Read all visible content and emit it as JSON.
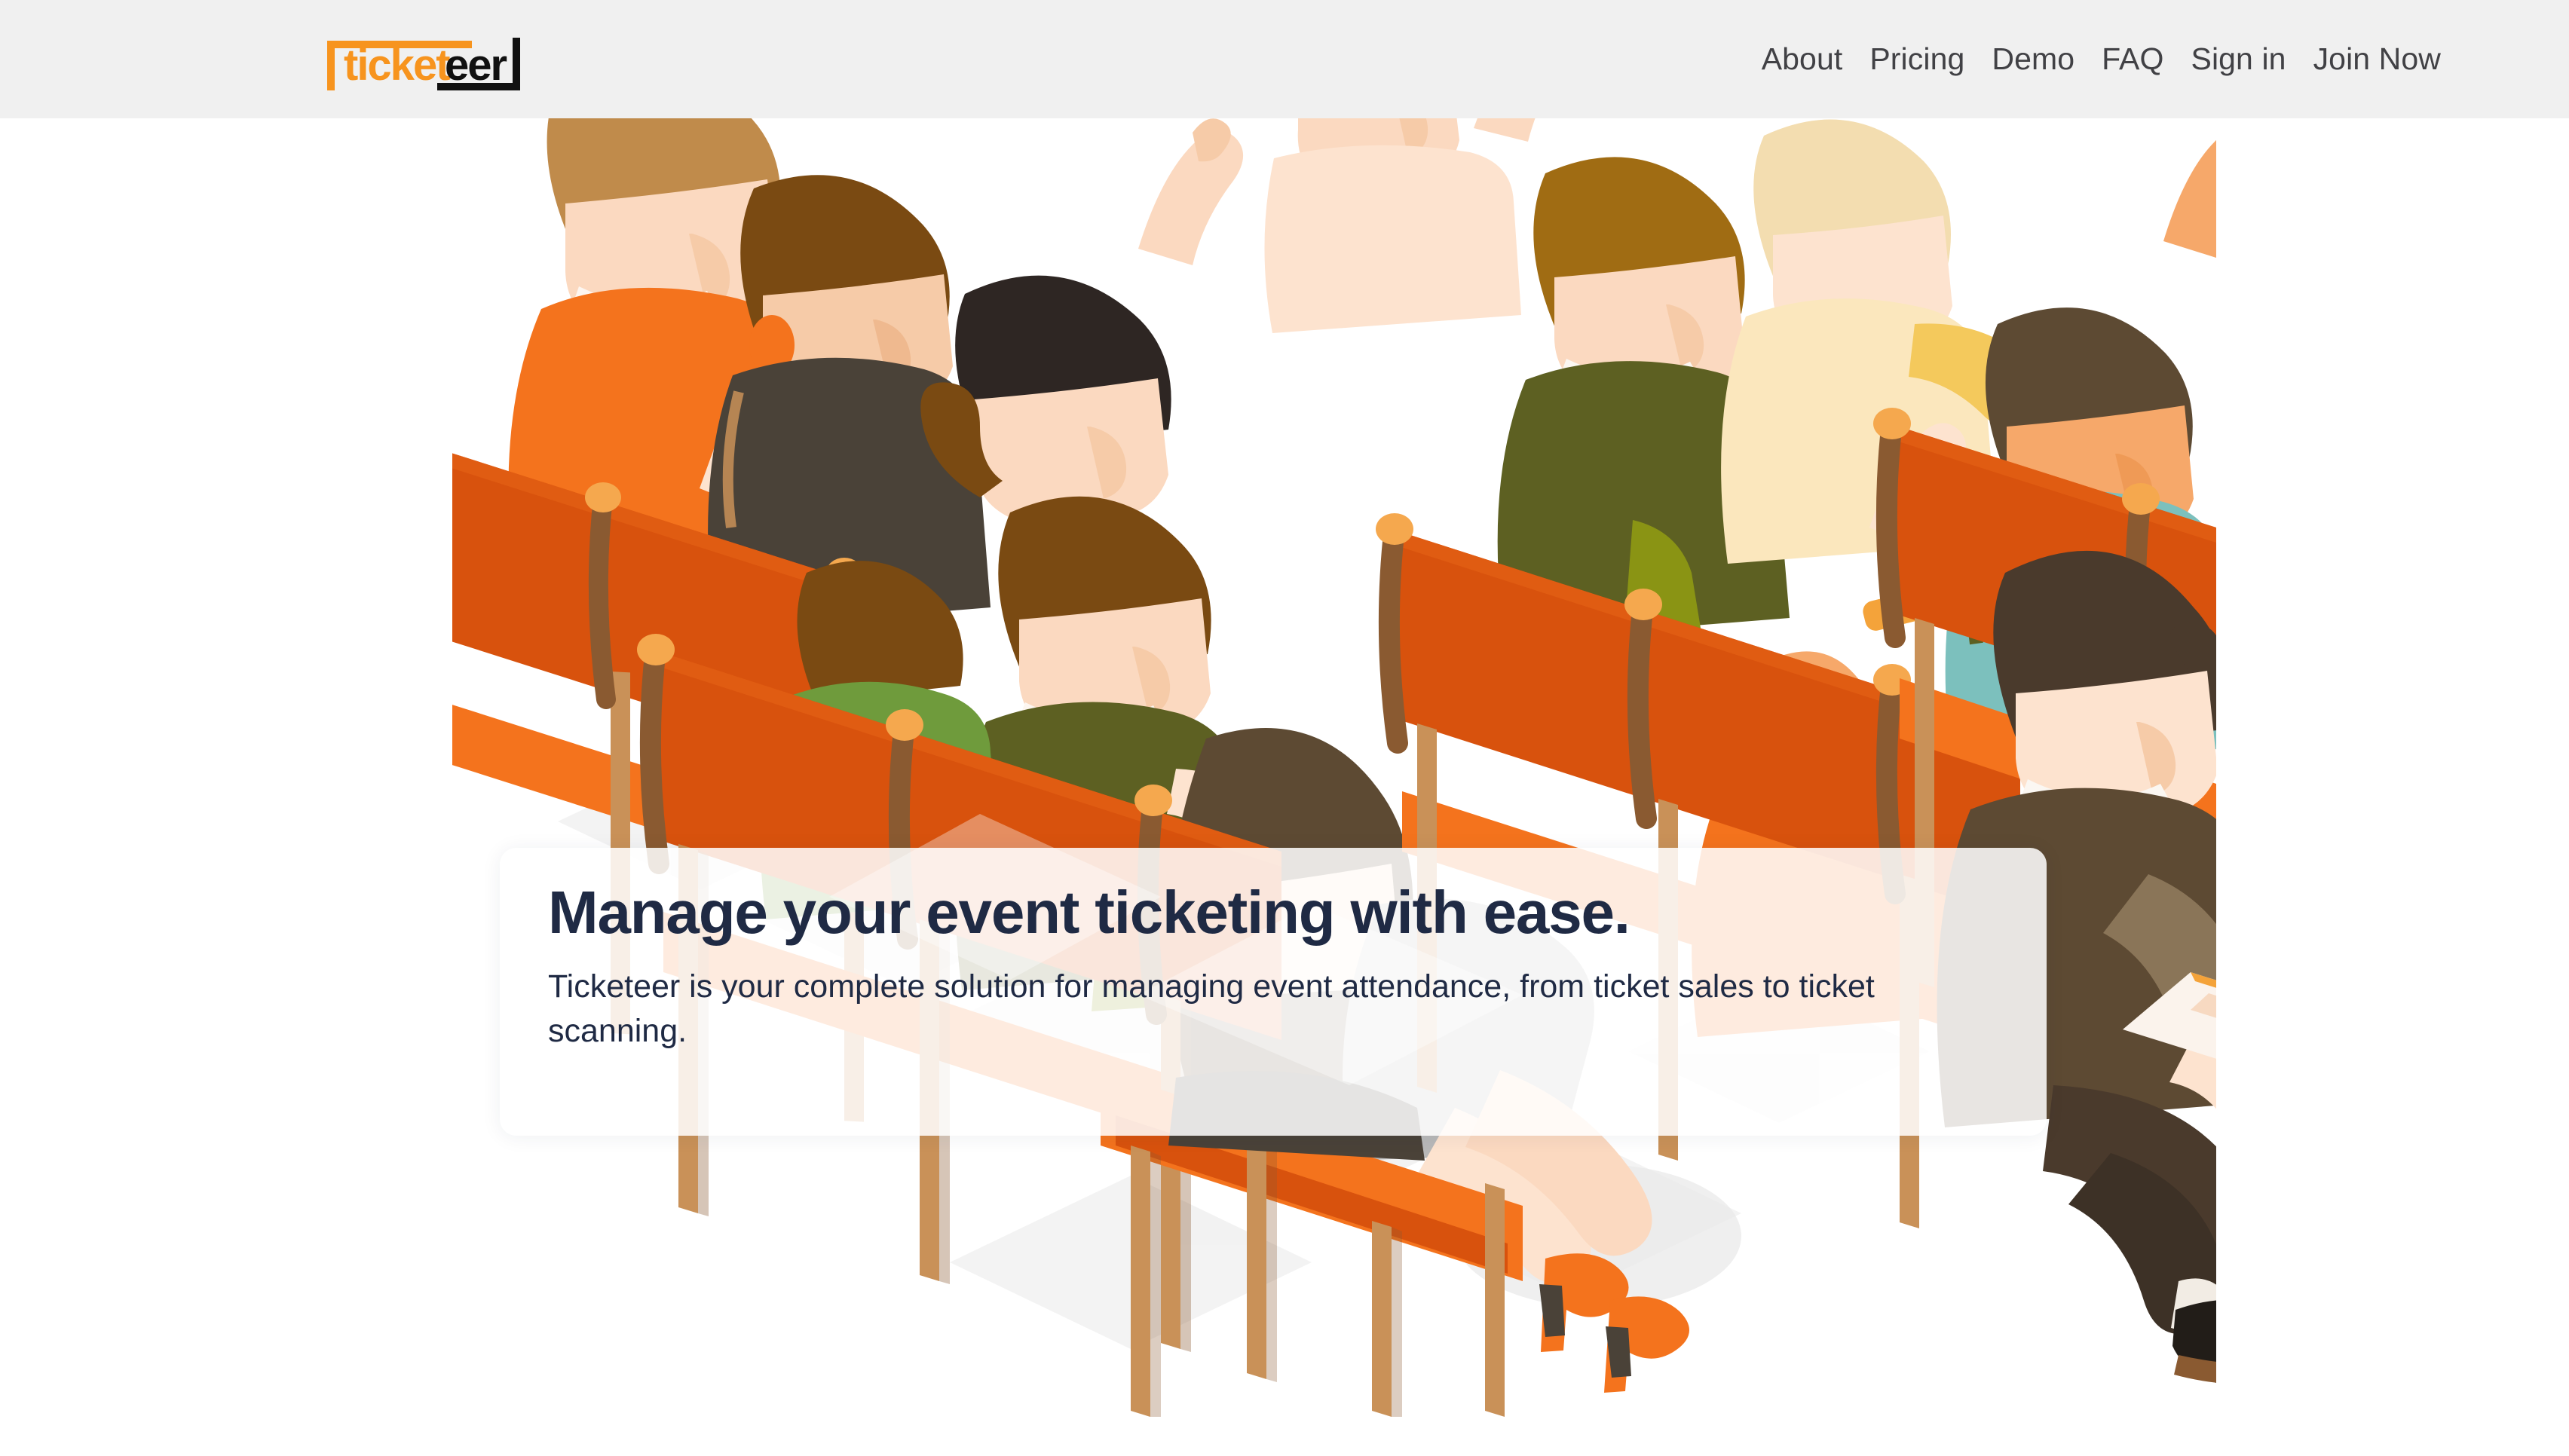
{
  "header": {
    "logo": {
      "name": "ticketeer-logo",
      "text_primary": "ticket",
      "text_secondary": "eer",
      "alt": "ticketeer",
      "color_primary": "#F7941E",
      "color_secondary": "#111111"
    },
    "nav": {
      "items": [
        {
          "label": "About",
          "name": "nav-link-about"
        },
        {
          "label": "Pricing",
          "name": "nav-link-pricing"
        },
        {
          "label": "Demo",
          "name": "nav-link-demo"
        },
        {
          "label": "FAQ",
          "name": "nav-link-faq"
        },
        {
          "label": "Sign in",
          "name": "nav-link-sign-in"
        },
        {
          "label": "Join Now",
          "name": "nav-link-join-now"
        }
      ]
    },
    "background_color": "#f0f0f0",
    "text_color": "#414145"
  },
  "hero": {
    "title": "Manage your event ticketing with ease.",
    "subtitle": "Ticketeer is your complete solution for managing event attendance, from ticket sales to ticket scanning.",
    "title_color": "#1f2a44",
    "card_background": "rgba(255,255,255,0.86)",
    "illustration_alt": "Audience seated in orange auditorium chairs with hands raised"
  },
  "palette": {
    "brand_orange": "#F7941E",
    "chair_orange": "#E2590F",
    "chair_orange_light": "#F4741C",
    "wood_light": "#C99158",
    "wood_dark": "#8A5A31",
    "joint_cap": "#F5A84E",
    "skin": "#F6CBA8",
    "skin_light": "#FBD9C0",
    "navy": "#1f2a44",
    "page_background": "#ffffff"
  }
}
